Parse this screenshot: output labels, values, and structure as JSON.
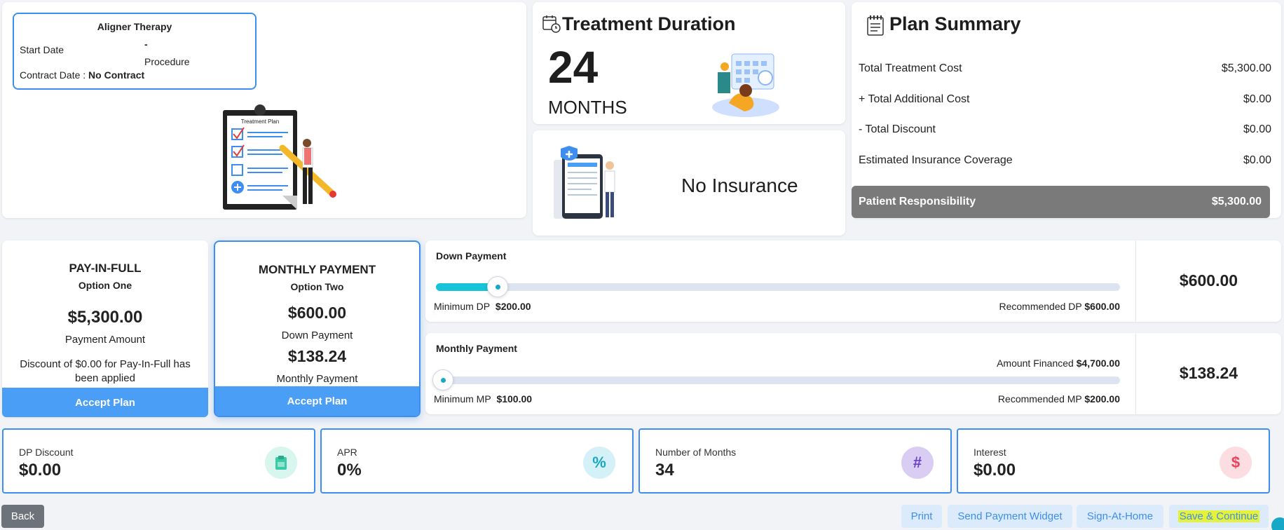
{
  "treatment": {
    "name": "Aligner Therapy",
    "start_date_label": "Start Date",
    "start_date_value": "-",
    "procedure_label": "Procedure",
    "contract_date_label": "Contract Date :",
    "contract_date_value": "No Contract",
    "illustration_text": "Treatment Plan"
  },
  "duration": {
    "title": "Treatment Duration",
    "value": "24",
    "unit": "MONTHS"
  },
  "insurance": {
    "status": "No Insurance"
  },
  "summary": {
    "title": "Plan Summary",
    "rows": [
      {
        "label": "Total Treatment Cost",
        "value": "$5,300.00"
      },
      {
        "label": "+ Total Additional Cost",
        "value": "$0.00"
      },
      {
        "label": "- Total Discount",
        "value": "$0.00"
      },
      {
        "label": "Estimated Insurance Coverage",
        "value": "$0.00"
      }
    ],
    "responsibility_label": "Patient Responsibility",
    "responsibility_value": "$5,300.00"
  },
  "option_one": {
    "title": "PAY-IN-FULL",
    "subtitle": "Option One",
    "amount": "$5,300.00",
    "amount_label": "Payment Amount",
    "note": "Discount of $0.00 for Pay-In-Full has been applied",
    "button": "Accept Plan"
  },
  "option_two": {
    "title": "MONTHLY PAYMENT",
    "subtitle": "Option Two",
    "down_amount": "$600.00",
    "down_label": "Down Payment",
    "monthly_amount": "$138.24",
    "monthly_label": "Monthly Payment",
    "button": "Accept Plan"
  },
  "down_payment_slider": {
    "title": "Down Payment",
    "min_label": "Minimum DP",
    "min_value": "$200.00",
    "rec_label": "Recommended DP",
    "rec_value": "$600.00",
    "current": "$600.00",
    "level": 0.09
  },
  "monthly_payment_slider": {
    "title": "Monthly Payment",
    "financed_label": "Amount Financed",
    "financed_value": "$4,700.00",
    "min_label": "Minimum MP",
    "min_value": "$100.00",
    "rec_label": "Recommended MP",
    "rec_value": "$200.00",
    "current": "$138.24",
    "level": 0.01
  },
  "stats": [
    {
      "label": "DP Discount",
      "value": "$0.00",
      "icon": "clipboard-icon",
      "color": "#3cc9a8",
      "bg": "#d8f6ee"
    },
    {
      "label": "APR",
      "value": "0%",
      "icon": "percent-icon",
      "color": "#1aa7c4",
      "bg": "#d4f1f7"
    },
    {
      "label": "Number of Months",
      "value": "34",
      "icon": "hash-icon",
      "color": "#6a3fc9",
      "bg": "#d9cdf3"
    },
    {
      "label": "Interest",
      "value": "$0.00",
      "icon": "dollar-icon",
      "color": "#e8455c",
      "bg": "#fbdde2"
    }
  ],
  "footer": {
    "back": "Back",
    "print": "Print",
    "send_widget": "Send Payment Widget",
    "sign_home": "Sign-At-Home",
    "save_continue": "Save & Continue"
  }
}
